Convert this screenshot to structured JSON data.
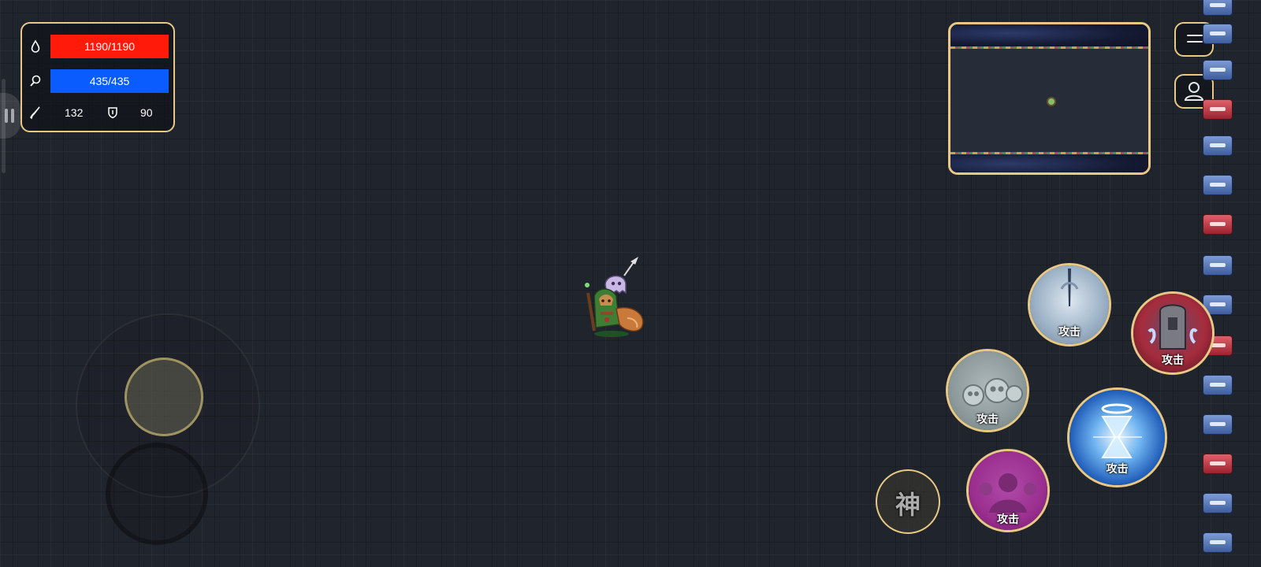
{
  "stats": {
    "hp_text": "1190/1190",
    "hp_fill": 1.0,
    "mp_text": "435/435",
    "mp_fill": 1.0,
    "attack": "132",
    "defense": "90",
    "hp_color": "#ff1a0a",
    "mp_color": "#0a5cff",
    "hp_icon": "drop-icon",
    "mp_icon": "mana-icon",
    "attack_icon": "sword-icon",
    "defense_icon": "shield-icon"
  },
  "top_right": {
    "menu_icon": "menu-icon",
    "profile_icon": "profile-icon"
  },
  "skills": {
    "skill_1_label": "攻击",
    "skill_2_label": "攻击",
    "skill_3_label": "攻击",
    "skill_4_label": "攻击",
    "skill_5_label": "攻击",
    "special_label": "神"
  },
  "colors": {
    "panel_border": "#e7c985",
    "background": "#20242c"
  }
}
